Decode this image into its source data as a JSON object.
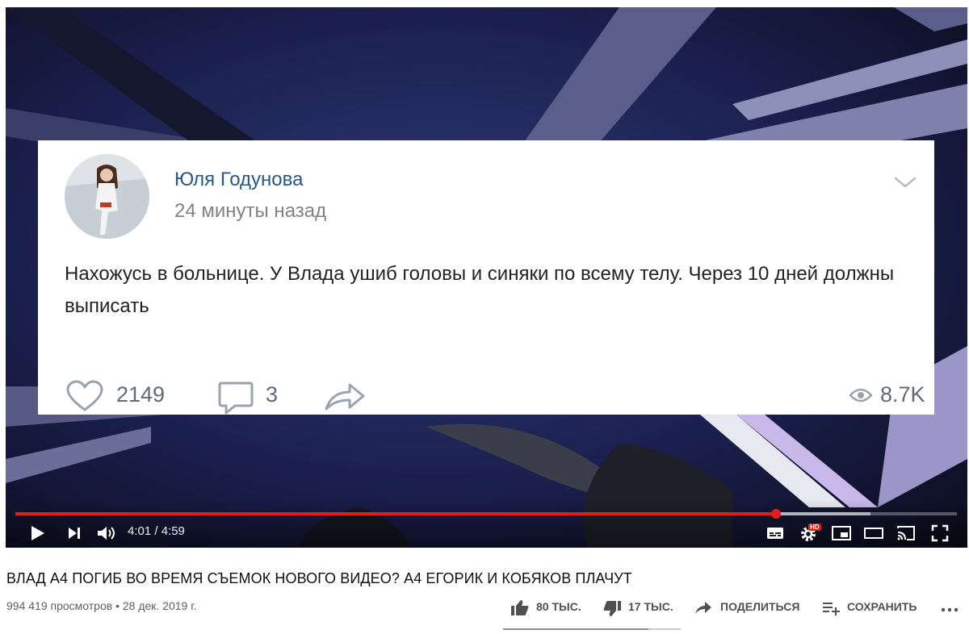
{
  "video": {
    "post": {
      "author": "Юля Годунова",
      "time": "24 минуты назад",
      "text": "Нахожусь в больнице. У Влада ушиб головы и синяки по всему телу. Через 10 дней должны выписать",
      "likes": "2149",
      "comments": "3",
      "views": "8.7K"
    },
    "player": {
      "timecode": "4:01 / 4:59",
      "progress_fraction": 0.808,
      "buffered_fraction": 0.908,
      "accent": "#e01e1e",
      "hd_badge": "HD"
    }
  },
  "info": {
    "title": "ВЛАД А4 ПОГИБ ВО ВРЕМЯ СЪЕМОК НОВОГО ВИДЕО? А4 ЕГОРИК И КОБЯКОВ ПЛАЧУТ",
    "meta": "994 419 просмотров • 28 дек. 2019 г.",
    "likes": "80 ТЫС.",
    "dislikes": "17 ТЫС.",
    "share": "ПОДЕЛИТЬСЯ",
    "save": "СОХРАНИТЬ",
    "like_ratio": 0.82
  }
}
